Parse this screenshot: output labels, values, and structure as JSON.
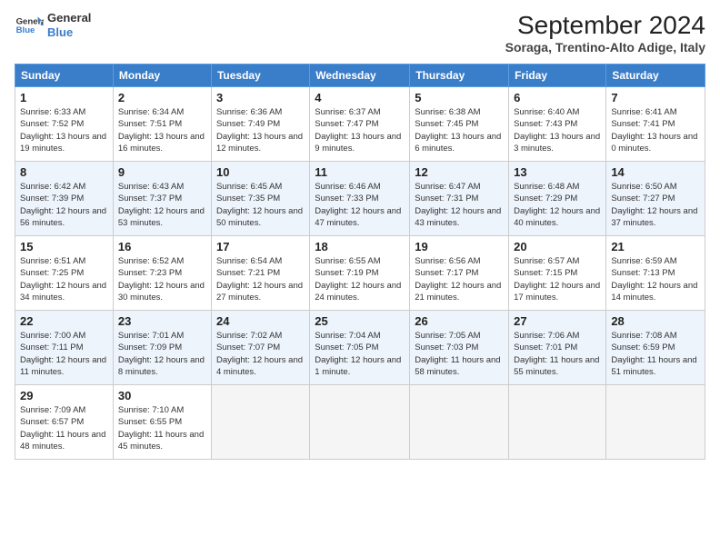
{
  "header": {
    "logo_line1": "General",
    "logo_line2": "Blue",
    "month": "September 2024",
    "location": "Soraga, Trentino-Alto Adige, Italy"
  },
  "weekdays": [
    "Sunday",
    "Monday",
    "Tuesday",
    "Wednesday",
    "Thursday",
    "Friday",
    "Saturday"
  ],
  "rows": [
    [
      {
        "day": "1",
        "rise": "Sunrise: 6:33 AM",
        "set": "Sunset: 7:52 PM",
        "daylight": "Daylight: 13 hours and 19 minutes."
      },
      {
        "day": "2",
        "rise": "Sunrise: 6:34 AM",
        "set": "Sunset: 7:51 PM",
        "daylight": "Daylight: 13 hours and 16 minutes."
      },
      {
        "day": "3",
        "rise": "Sunrise: 6:36 AM",
        "set": "Sunset: 7:49 PM",
        "daylight": "Daylight: 13 hours and 12 minutes."
      },
      {
        "day": "4",
        "rise": "Sunrise: 6:37 AM",
        "set": "Sunset: 7:47 PM",
        "daylight": "Daylight: 13 hours and 9 minutes."
      },
      {
        "day": "5",
        "rise": "Sunrise: 6:38 AM",
        "set": "Sunset: 7:45 PM",
        "daylight": "Daylight: 13 hours and 6 minutes."
      },
      {
        "day": "6",
        "rise": "Sunrise: 6:40 AM",
        "set": "Sunset: 7:43 PM",
        "daylight": "Daylight: 13 hours and 3 minutes."
      },
      {
        "day": "7",
        "rise": "Sunrise: 6:41 AM",
        "set": "Sunset: 7:41 PM",
        "daylight": "Daylight: 13 hours and 0 minutes."
      }
    ],
    [
      {
        "day": "8",
        "rise": "Sunrise: 6:42 AM",
        "set": "Sunset: 7:39 PM",
        "daylight": "Daylight: 12 hours and 56 minutes."
      },
      {
        "day": "9",
        "rise": "Sunrise: 6:43 AM",
        "set": "Sunset: 7:37 PM",
        "daylight": "Daylight: 12 hours and 53 minutes."
      },
      {
        "day": "10",
        "rise": "Sunrise: 6:45 AM",
        "set": "Sunset: 7:35 PM",
        "daylight": "Daylight: 12 hours and 50 minutes."
      },
      {
        "day": "11",
        "rise": "Sunrise: 6:46 AM",
        "set": "Sunset: 7:33 PM",
        "daylight": "Daylight: 12 hours and 47 minutes."
      },
      {
        "day": "12",
        "rise": "Sunrise: 6:47 AM",
        "set": "Sunset: 7:31 PM",
        "daylight": "Daylight: 12 hours and 43 minutes."
      },
      {
        "day": "13",
        "rise": "Sunrise: 6:48 AM",
        "set": "Sunset: 7:29 PM",
        "daylight": "Daylight: 12 hours and 40 minutes."
      },
      {
        "day": "14",
        "rise": "Sunrise: 6:50 AM",
        "set": "Sunset: 7:27 PM",
        "daylight": "Daylight: 12 hours and 37 minutes."
      }
    ],
    [
      {
        "day": "15",
        "rise": "Sunrise: 6:51 AM",
        "set": "Sunset: 7:25 PM",
        "daylight": "Daylight: 12 hours and 34 minutes."
      },
      {
        "day": "16",
        "rise": "Sunrise: 6:52 AM",
        "set": "Sunset: 7:23 PM",
        "daylight": "Daylight: 12 hours and 30 minutes."
      },
      {
        "day": "17",
        "rise": "Sunrise: 6:54 AM",
        "set": "Sunset: 7:21 PM",
        "daylight": "Daylight: 12 hours and 27 minutes."
      },
      {
        "day": "18",
        "rise": "Sunrise: 6:55 AM",
        "set": "Sunset: 7:19 PM",
        "daylight": "Daylight: 12 hours and 24 minutes."
      },
      {
        "day": "19",
        "rise": "Sunrise: 6:56 AM",
        "set": "Sunset: 7:17 PM",
        "daylight": "Daylight: 12 hours and 21 minutes."
      },
      {
        "day": "20",
        "rise": "Sunrise: 6:57 AM",
        "set": "Sunset: 7:15 PM",
        "daylight": "Daylight: 12 hours and 17 minutes."
      },
      {
        "day": "21",
        "rise": "Sunrise: 6:59 AM",
        "set": "Sunset: 7:13 PM",
        "daylight": "Daylight: 12 hours and 14 minutes."
      }
    ],
    [
      {
        "day": "22",
        "rise": "Sunrise: 7:00 AM",
        "set": "Sunset: 7:11 PM",
        "daylight": "Daylight: 12 hours and 11 minutes."
      },
      {
        "day": "23",
        "rise": "Sunrise: 7:01 AM",
        "set": "Sunset: 7:09 PM",
        "daylight": "Daylight: 12 hours and 8 minutes."
      },
      {
        "day": "24",
        "rise": "Sunrise: 7:02 AM",
        "set": "Sunset: 7:07 PM",
        "daylight": "Daylight: 12 hours and 4 minutes."
      },
      {
        "day": "25",
        "rise": "Sunrise: 7:04 AM",
        "set": "Sunset: 7:05 PM",
        "daylight": "Daylight: 12 hours and 1 minute."
      },
      {
        "day": "26",
        "rise": "Sunrise: 7:05 AM",
        "set": "Sunset: 7:03 PM",
        "daylight": "Daylight: 11 hours and 58 minutes."
      },
      {
        "day": "27",
        "rise": "Sunrise: 7:06 AM",
        "set": "Sunset: 7:01 PM",
        "daylight": "Daylight: 11 hours and 55 minutes."
      },
      {
        "day": "28",
        "rise": "Sunrise: 7:08 AM",
        "set": "Sunset: 6:59 PM",
        "daylight": "Daylight: 11 hours and 51 minutes."
      }
    ],
    [
      {
        "day": "29",
        "rise": "Sunrise: 7:09 AM",
        "set": "Sunset: 6:57 PM",
        "daylight": "Daylight: 11 hours and 48 minutes."
      },
      {
        "day": "30",
        "rise": "Sunrise: 7:10 AM",
        "set": "Sunset: 6:55 PM",
        "daylight": "Daylight: 11 hours and 45 minutes."
      },
      null,
      null,
      null,
      null,
      null
    ]
  ]
}
